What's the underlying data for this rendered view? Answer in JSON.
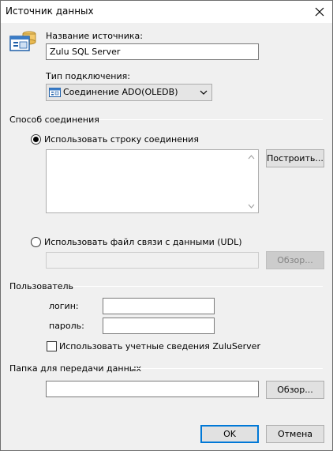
{
  "window": {
    "title": "Источник данных"
  },
  "source": {
    "name_label": "Название источника:",
    "name_value": "Zulu SQL Server",
    "conn_type_label": "Тип подключения:",
    "conn_type_value": "Соединение ADO(OLEDB)"
  },
  "connection": {
    "group_label": "Способ соединения",
    "use_string_label": "Использовать строку соединения",
    "connection_string": "",
    "build_button": "Построить...",
    "use_udl_label": "Использовать файл связи с данными (UDL)",
    "udl_path": "",
    "udl_browse_button": "Обзор..."
  },
  "user": {
    "group_label": "Пользователь",
    "login_label": "логин:",
    "login_value": "",
    "password_label": "пароль:",
    "password_value": "",
    "use_zulu_creds_label": "Использовать учетные сведения ZuluServer"
  },
  "transfer": {
    "group_label": "Папка для передачи данных",
    "folder_value": "",
    "browse_button": "Обзор..."
  },
  "footer": {
    "ok_button": "OK",
    "cancel_button": "Отмена"
  },
  "colors": {
    "window_bg": "#f0f0f0",
    "accent": "#0078d7"
  }
}
